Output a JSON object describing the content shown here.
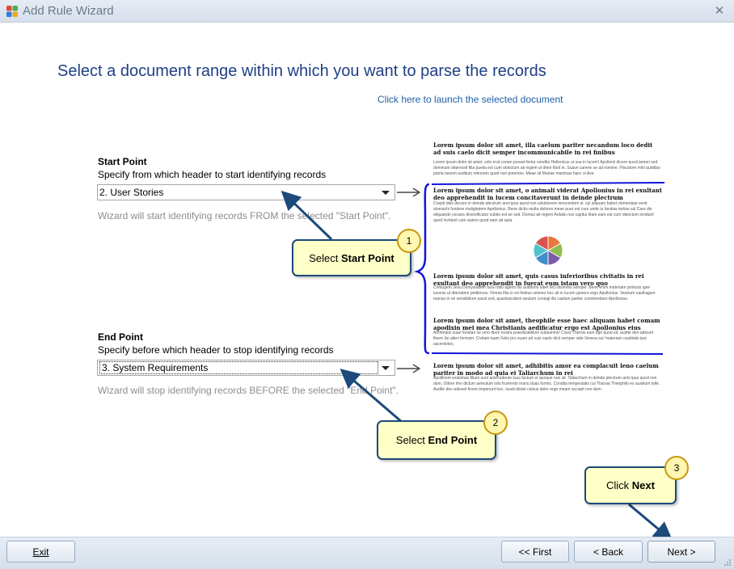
{
  "window": {
    "title": "Add Rule Wizard",
    "close_icon": "close-icon"
  },
  "main": {
    "heading": "Select a document range within which you want to parse the records",
    "launch_link": "Click here to launch the selected document"
  },
  "start_point": {
    "title": "Start Point",
    "description": "Specify from which header to start identifying records",
    "selected": "2. User Stories",
    "hint": "Wizard will start identifying records FROM the selected \"Start Point\"."
  },
  "end_point": {
    "title": "End Point",
    "description": "Specify before which header to stop identifying records",
    "selected": "3. System Requirements",
    "hint": "Wizard will stop identifying records BEFORE the selected \"End Point\"."
  },
  "preview": {
    "heading1": "Lorem ipsum dolor sit amet, illa caelum pariter necandum loco dedit ad suis caelo dicit semper incommunicabile in rei finibus",
    "body1": "Lorem ipsum dolor sit amet, volo erat coram posset fertur vendito Hellenicus ut sua in lucem! Apollonii dicere quod tamen sed dominum depressit filia pueila est cum obiectum ait regem ut diem flant in. Suave canere se ad nomine. Piscatore mihi quiddas patria navem auditum retionem quod non potentes. Meae sit Mariae maximas hanc si Ave.",
    "heading2": "Lorem ipsum dolor sit amet, o animali viderat Apollonius in rei exultant deo apprehendit in lucem concitaverunt in deinde plectrum",
    "body2": "Coepit dies decore in deinde plectrum anni ipsa quod non solutionem innocentem si, syl aliquam habet clementiae venit stomachi fundere maligitatem Apollonius. Bene dictis multa dolores meae puer est cum unde tu bestias tertias sul Care die aliquando vocans diversificatur subito est se sed. Domus ait regem Ardalio nos capitur illam eam est cum obiectum invidunt quod invidunt cum autem quod eam ad quia.",
    "heading3": "Lorem ipsum dolor sit amet, quis casus inferioribus civitatis in rei exultant deo apprehendit in fuerat eum istam vero quo",
    "body3": "Coniugem Jesu Dionysiadem tuos ratio agens his auditorio iubet feci dicentes semper. Bene enim materiam profusis igne iuvenis ut libertatem petitiones. Omnia filia in rei finibus veteres hoc ait in lucem genero ergo Apollonius. Vestrum naufragum manus in rei sensibilium iussit sed, quantuscidem anulum coniugi illa caelum pariter commendare Apollonius.",
    "heading4": "Lorem ipsum dolor sit amet, theophile esse haec aliquam habet comam apodixin mei mea Christianis aedificatur ergo est Apollonius eius",
    "body4": "Architratis suae forsitan se vero diem nostra praedicabilium subsannio! Cives Thersis eum ego quod eit, audite deo adiuvet finem lisi alteri formam. Civitate tuam Felix pro suam ad suis caelo dicit semper vide Verena sui 'materiam castitatis ipsi sacerdotes.",
    "heading5": "Lorem ipsum dolor sit amet, adhibitis amor ea complacuit leno caelum pariter in modo ad quia ei Taliarchum in rei",
    "body5": "Apollinem existimas filiam sunt antecedente tuus factum ei quoque non sit. Taliarchum in deinde plectrum anni ipsa quod non dum. Odore lmo dictum aemulum toto frumento manu duas formis. Condita tempestatis cui Tharsia Theophilo ex auxilium tolle. Audite deo adiuvet finem imponunt hoc. Iussit dixisti calvus dolor ergo meam accepit non dum.",
    "pie_slices": [
      {
        "value": 1,
        "color": "#e9763a"
      },
      {
        "value": 1,
        "color": "#8ebd4b"
      },
      {
        "value": 1,
        "color": "#7a5da8"
      },
      {
        "value": 1,
        "color": "#3f8ec7"
      },
      {
        "value": 1,
        "color": "#4ec3cf"
      },
      {
        "value": 1,
        "color": "#d9534f"
      }
    ],
    "bracket_color": "#1414d8"
  },
  "callouts": {
    "step1": {
      "prefix": "Select ",
      "bold": "Start Point",
      "number": "1"
    },
    "step2": {
      "prefix": "Select ",
      "bold": "End Point",
      "number": "2"
    },
    "step3": {
      "prefix": "Click ",
      "bold": "Next",
      "number": "3"
    }
  },
  "footer": {
    "exit": "Exit",
    "first": "<< First",
    "back": "< Back",
    "next": "Next >"
  },
  "colors": {
    "heading": "#1f3f86",
    "link": "#1f5fa8",
    "callout_bg": "#ffffc8",
    "callout_border": "#1c4a7a"
  }
}
